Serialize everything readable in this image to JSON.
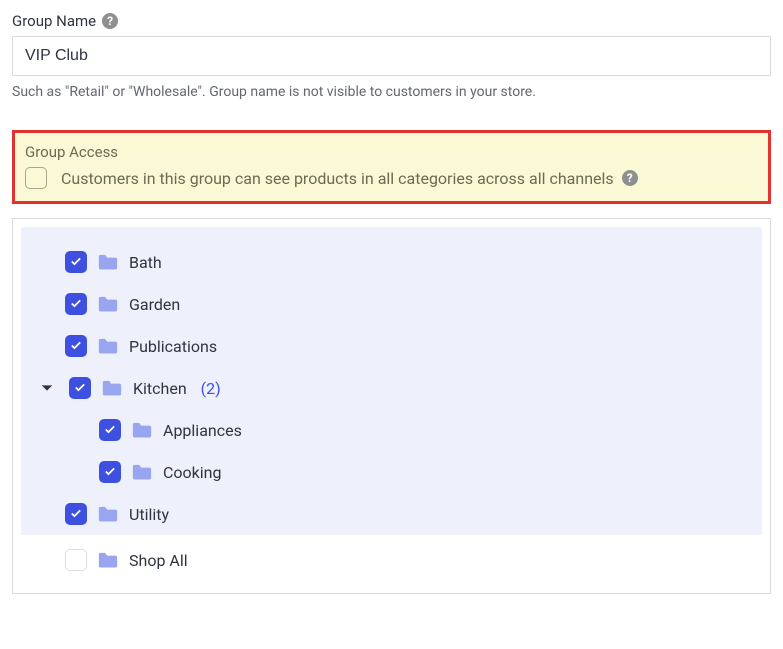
{
  "group_name": {
    "label": "Group Name",
    "value": "VIP Club",
    "hint": "Such as \"Retail\" or \"Wholesale\". Group name is not visible to customers in your store."
  },
  "access": {
    "title": "Group Access",
    "text": "Customers in this group can see products in all categories across all channels",
    "checked": false
  },
  "tree": {
    "items": [
      {
        "label": "Bath",
        "checked": true
      },
      {
        "label": "Garden",
        "checked": true
      },
      {
        "label": "Publications",
        "checked": true
      },
      {
        "label": "Kitchen",
        "checked": true,
        "count": "(2)",
        "expanded": true,
        "children": [
          {
            "label": "Appliances",
            "checked": true
          },
          {
            "label": "Cooking",
            "checked": true
          }
        ]
      },
      {
        "label": "Utility",
        "checked": true
      },
      {
        "label": "Shop All",
        "checked": false
      }
    ]
  },
  "colors": {
    "accent": "#3e50e0",
    "highlight_bg": "#fbf9d5",
    "highlight_border": "#e53030"
  }
}
